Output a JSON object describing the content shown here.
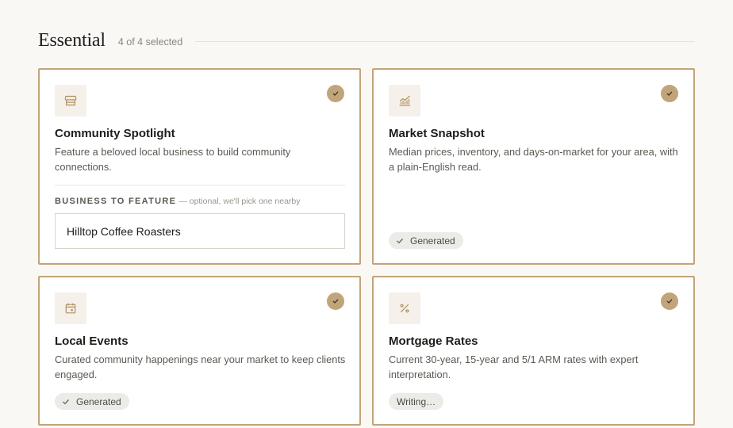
{
  "section": {
    "title": "Essential",
    "count": "4 of 4 selected"
  },
  "cards": [
    {
      "title": "Community Spotlight",
      "description": "Feature a beloved local business to build community connections.",
      "icon": "storefront-icon",
      "selected": true,
      "field": {
        "label": "BUSINESS TO FEATURE",
        "hint": "— optional, we'll pick one nearby",
        "value": "Hilltop Coffee Roasters"
      }
    },
    {
      "title": "Market Snapshot",
      "description": "Median prices, inventory, and days-on-market for your area, with a plain-English read.",
      "icon": "chart-line-icon",
      "selected": true,
      "status": "Generated"
    },
    {
      "title": "Local Events",
      "description": "Curated community happenings near your market to keep clients engaged.",
      "icon": "calendar-icon",
      "selected": true,
      "status": "Generated"
    },
    {
      "title": "Mortgage Rates",
      "description": "Current 30-year, 15-year and 5/1 ARM rates with expert interpretation.",
      "icon": "percent-icon",
      "selected": true,
      "status": "Writing…"
    }
  ],
  "colors": {
    "accent": "#c2a47a",
    "background": "#f9f8f5",
    "pill": "#ebece8"
  }
}
